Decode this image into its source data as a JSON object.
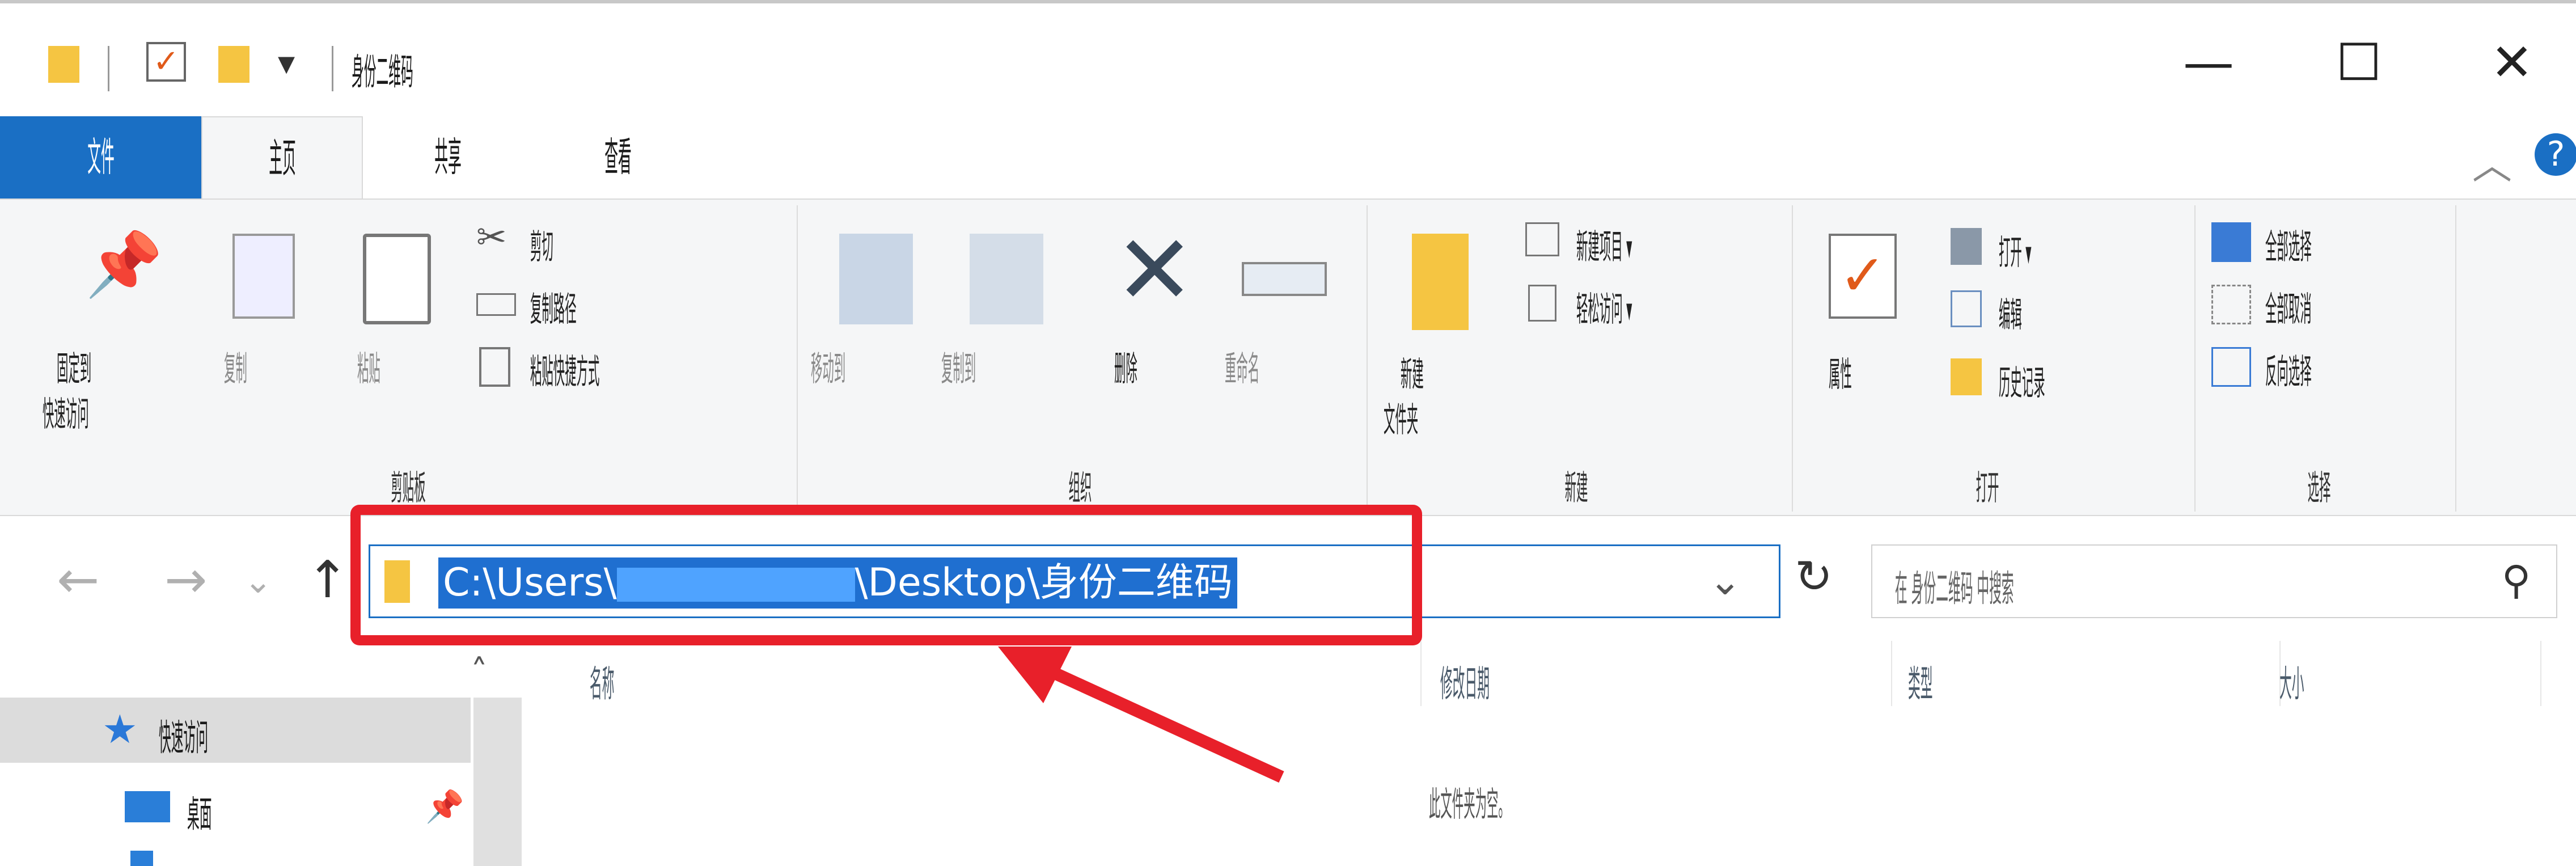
{
  "window": {
    "title": "身份二维码",
    "controls": {
      "minimize": "—",
      "maximize": "☐",
      "close": "✕"
    }
  },
  "tabs": [
    "文件",
    "主页",
    "共享",
    "查看"
  ],
  "ribbon": {
    "clipboard": {
      "pin_line1": "固定到",
      "pin_line2": "快速访问",
      "copy": "复制",
      "paste": "粘贴",
      "cut": "剪切",
      "copy_path": "复制路径",
      "paste_shortcut": "粘贴快捷方式",
      "group": "剪贴板"
    },
    "organize": {
      "move_to": "移动到",
      "copy_to": "复制到",
      "delete": "删除",
      "rename": "重命名",
      "group": "组织"
    },
    "new": {
      "new_folder_line1": "新建",
      "new_folder_line2": "文件夹",
      "new_item": "新建项目 ▾",
      "easy_access": "轻松访问 ▾",
      "group": "新建"
    },
    "open": {
      "properties": "属性",
      "open": "打开 ▾",
      "edit": "编辑",
      "history": "历史记录",
      "group": "打开"
    },
    "select": {
      "select_all": "全部选择",
      "select_none": "全部取消",
      "invert": "反向选择",
      "group": "选择"
    }
  },
  "address": {
    "path_start": "C:\\Users\\",
    "path_end": "\\Desktop\\身份二维码",
    "search_placeholder": "在 身份二维码 中搜索"
  },
  "sidebar": {
    "quick_access": "快速访问",
    "desktop": "桌面"
  },
  "columns": [
    "名称",
    "修改日期",
    "类型",
    "大小"
  ],
  "empty_message": "此文件夹为空。",
  "colors": {
    "accent": "#1a6fc4",
    "highlight": "#e8202a",
    "folder": "#f5c542"
  }
}
